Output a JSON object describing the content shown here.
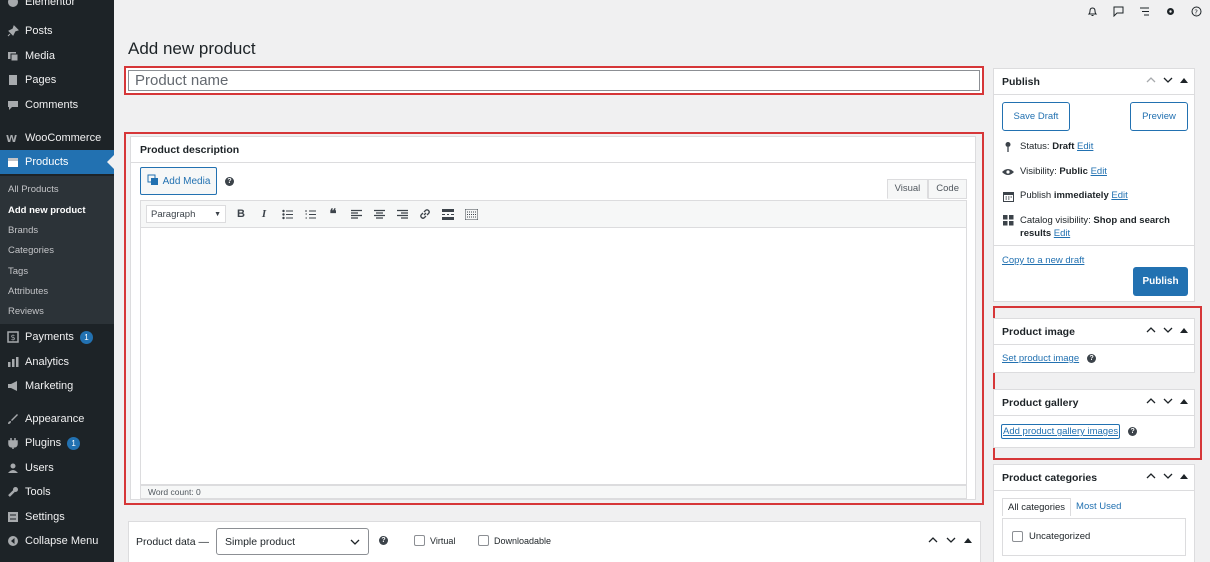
{
  "sidebar": {
    "items": [
      {
        "label": "Elementor",
        "icon": "elementor-icon"
      },
      {
        "label": "Posts",
        "icon": "pin-icon"
      },
      {
        "label": "Media",
        "icon": "media-icon"
      },
      {
        "label": "Pages",
        "icon": "pages-icon"
      },
      {
        "label": "Comments",
        "icon": "comments-icon"
      },
      {
        "label": "WooCommerce",
        "icon": "woo-icon"
      },
      {
        "label": "Products",
        "icon": "products-icon"
      },
      {
        "label": "Payments",
        "icon": "payments-icon",
        "badge": "1"
      },
      {
        "label": "Analytics",
        "icon": "analytics-icon"
      },
      {
        "label": "Marketing",
        "icon": "marketing-icon"
      },
      {
        "label": "Appearance",
        "icon": "appearance-icon"
      },
      {
        "label": "Plugins",
        "icon": "plugins-icon",
        "badge": "1"
      },
      {
        "label": "Users",
        "icon": "users-icon"
      },
      {
        "label": "Tools",
        "icon": "tools-icon"
      },
      {
        "label": "Settings",
        "icon": "settings-icon"
      },
      {
        "label": "Collapse Menu",
        "icon": "collapse-icon"
      }
    ],
    "submenu": [
      "All Products",
      "Add new product",
      "Brands",
      "Categories",
      "Tags",
      "Attributes",
      "Reviews"
    ]
  },
  "page": {
    "title": "Add new product",
    "name_placeholder": "Product name"
  },
  "description": {
    "title": "Product description",
    "add_media": "Add Media",
    "tab_visual": "Visual",
    "tab_code": "Code",
    "format": "Paragraph",
    "word_count": "Word count: 0"
  },
  "product_data": {
    "label": "Product data —",
    "type": "Simple product",
    "virtual": "Virtual",
    "downloadable": "Downloadable"
  },
  "publish": {
    "title": "Publish",
    "save_draft": "Save Draft",
    "preview": "Preview",
    "status_label": "Status:",
    "status_value": "Draft",
    "visibility_label": "Visibility:",
    "visibility_value": "Public",
    "publish_label": "Publish",
    "publish_value": "immediately",
    "catalog_label": "Catalog visibility:",
    "catalog_value": "Shop and search",
    "catalog_value2": "results",
    "edit": "Edit",
    "copy_draft": "Copy to a new draft",
    "publish_btn": "Publish"
  },
  "product_image": {
    "title": "Product image",
    "link": "Set product image"
  },
  "product_gallery": {
    "title": "Product gallery",
    "link": "Add product gallery images"
  },
  "categories": {
    "title": "Product categories",
    "tab_all": "All categories",
    "tab_used": "Most Used",
    "item": "Uncategorized"
  },
  "colors": {
    "sidebar": "#1d2327",
    "accent": "#2271b1",
    "highlight": "#d63638"
  }
}
